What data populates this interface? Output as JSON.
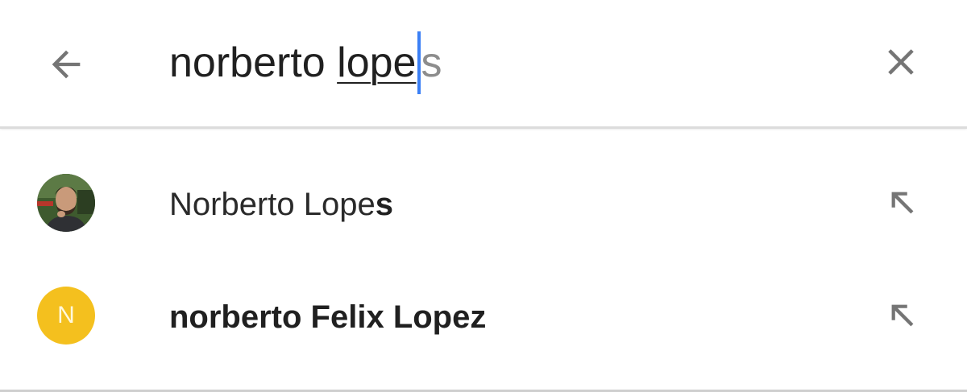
{
  "search": {
    "query_typed": "norberto ",
    "query_composing": "lope",
    "query_hint": "s",
    "back_icon": "arrow-back-icon",
    "clear_icon": "close-icon"
  },
  "suggestions": [
    {
      "parts": [
        {
          "text": "Norberto Lope",
          "bold": false
        },
        {
          "text": "s",
          "bold": true
        }
      ],
      "avatar_type": "photo",
      "fill_icon": "arrow-up-left-icon"
    },
    {
      "parts": [
        {
          "text": "norberto Felix Lopez",
          "bold": true
        }
      ],
      "avatar_type": "letter",
      "avatar_letter": "N",
      "avatar_color": "#f4c01e",
      "fill_icon": "arrow-up-left-icon"
    }
  ],
  "colors": {
    "caret": "#3b7ff5",
    "icon_gray": "#757575",
    "hint_gray": "#8d8d8d"
  }
}
